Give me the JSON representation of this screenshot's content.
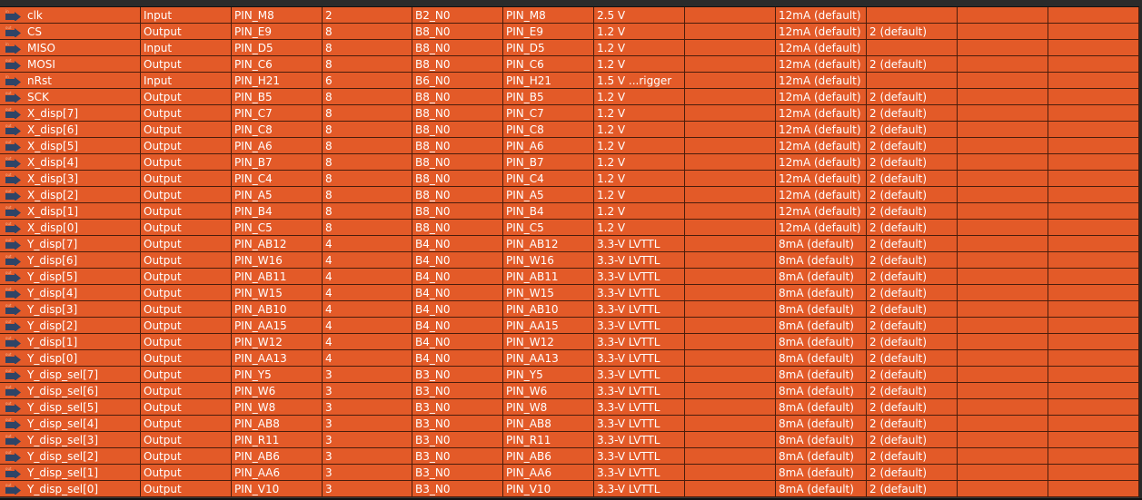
{
  "colors": {
    "row_bg": "#e35a28",
    "grid_line": "#4a1d0c",
    "text": "#ffffff",
    "background": "#3a3a3a"
  },
  "icons": {
    "input": "input-pin-icon",
    "output": "output-pin-icon"
  },
  "rows": [
    {
      "name": "clk",
      "direction": "Input",
      "location": "PIN_M8",
      "bank": "2",
      "vref": "B2_N0",
      "fitter": "PIN_M8",
      "io_std": "2.5 V",
      "reserved": "",
      "current": "12mA (default)",
      "slew": ""
    },
    {
      "name": "CS",
      "direction": "Output",
      "location": "PIN_E9",
      "bank": "8",
      "vref": "B8_N0",
      "fitter": "PIN_E9",
      "io_std": "1.2 V",
      "reserved": "",
      "current": "12mA (default)",
      "slew": "2 (default)"
    },
    {
      "name": "MISO",
      "direction": "Input",
      "location": "PIN_D5",
      "bank": "8",
      "vref": "B8_N0",
      "fitter": "PIN_D5",
      "io_std": "1.2 V",
      "reserved": "",
      "current": "12mA (default)",
      "slew": ""
    },
    {
      "name": "MOSI",
      "direction": "Output",
      "location": "PIN_C6",
      "bank": "8",
      "vref": "B8_N0",
      "fitter": "PIN_C6",
      "io_std": "1.2 V",
      "reserved": "",
      "current": "12mA (default)",
      "slew": "2 (default)"
    },
    {
      "name": "nRst",
      "direction": "Input",
      "location": "PIN_H21",
      "bank": "6",
      "vref": "B6_N0",
      "fitter": "PIN_H21",
      "io_std": "1.5 V ...rigger",
      "reserved": "",
      "current": "12mA (default)",
      "slew": ""
    },
    {
      "name": "SCK",
      "direction": "Output",
      "location": "PIN_B5",
      "bank": "8",
      "vref": "B8_N0",
      "fitter": "PIN_B5",
      "io_std": "1.2 V",
      "reserved": "",
      "current": "12mA (default)",
      "slew": "2 (default)"
    },
    {
      "name": "X_disp[7]",
      "direction": "Output",
      "location": "PIN_C7",
      "bank": "8",
      "vref": "B8_N0",
      "fitter": "PIN_C7",
      "io_std": "1.2 V",
      "reserved": "",
      "current": "12mA (default)",
      "slew": "2 (default)"
    },
    {
      "name": "X_disp[6]",
      "direction": "Output",
      "location": "PIN_C8",
      "bank": "8",
      "vref": "B8_N0",
      "fitter": "PIN_C8",
      "io_std": "1.2 V",
      "reserved": "",
      "current": "12mA (default)",
      "slew": "2 (default)"
    },
    {
      "name": "X_disp[5]",
      "direction": "Output",
      "location": "PIN_A6",
      "bank": "8",
      "vref": "B8_N0",
      "fitter": "PIN_A6",
      "io_std": "1.2 V",
      "reserved": "",
      "current": "12mA (default)",
      "slew": "2 (default)"
    },
    {
      "name": "X_disp[4]",
      "direction": "Output",
      "location": "PIN_B7",
      "bank": "8",
      "vref": "B8_N0",
      "fitter": "PIN_B7",
      "io_std": "1.2 V",
      "reserved": "",
      "current": "12mA (default)",
      "slew": "2 (default)"
    },
    {
      "name": "X_disp[3]",
      "direction": "Output",
      "location": "PIN_C4",
      "bank": "8",
      "vref": "B8_N0",
      "fitter": "PIN_C4",
      "io_std": "1.2 V",
      "reserved": "",
      "current": "12mA (default)",
      "slew": "2 (default)"
    },
    {
      "name": "X_disp[2]",
      "direction": "Output",
      "location": "PIN_A5",
      "bank": "8",
      "vref": "B8_N0",
      "fitter": "PIN_A5",
      "io_std": "1.2 V",
      "reserved": "",
      "current": "12mA (default)",
      "slew": "2 (default)"
    },
    {
      "name": "X_disp[1]",
      "direction": "Output",
      "location": "PIN_B4",
      "bank": "8",
      "vref": "B8_N0",
      "fitter": "PIN_B4",
      "io_std": "1.2 V",
      "reserved": "",
      "current": "12mA (default)",
      "slew": "2 (default)"
    },
    {
      "name": "X_disp[0]",
      "direction": "Output",
      "location": "PIN_C5",
      "bank": "8",
      "vref": "B8_N0",
      "fitter": "PIN_C5",
      "io_std": "1.2 V",
      "reserved": "",
      "current": "12mA (default)",
      "slew": "2 (default)"
    },
    {
      "name": "Y_disp[7]",
      "direction": "Output",
      "location": "PIN_AB12",
      "bank": "4",
      "vref": "B4_N0",
      "fitter": "PIN_AB12",
      "io_std": "3.3-V LVTTL",
      "reserved": "",
      "current": "8mA (default)",
      "slew": "2 (default)"
    },
    {
      "name": "Y_disp[6]",
      "direction": "Output",
      "location": "PIN_W16",
      "bank": "4",
      "vref": "B4_N0",
      "fitter": "PIN_W16",
      "io_std": "3.3-V LVTTL",
      "reserved": "",
      "current": "8mA (default)",
      "slew": "2 (default)"
    },
    {
      "name": "Y_disp[5]",
      "direction": "Output",
      "location": "PIN_AB11",
      "bank": "4",
      "vref": "B4_N0",
      "fitter": "PIN_AB11",
      "io_std": "3.3-V LVTTL",
      "reserved": "",
      "current": "8mA (default)",
      "slew": "2 (default)"
    },
    {
      "name": "Y_disp[4]",
      "direction": "Output",
      "location": "PIN_W15",
      "bank": "4",
      "vref": "B4_N0",
      "fitter": "PIN_W15",
      "io_std": "3.3-V LVTTL",
      "reserved": "",
      "current": "8mA (default)",
      "slew": "2 (default)"
    },
    {
      "name": "Y_disp[3]",
      "direction": "Output",
      "location": "PIN_AB10",
      "bank": "4",
      "vref": "B4_N0",
      "fitter": "PIN_AB10",
      "io_std": "3.3-V LVTTL",
      "reserved": "",
      "current": "8mA (default)",
      "slew": "2 (default)"
    },
    {
      "name": "Y_disp[2]",
      "direction": "Output",
      "location": "PIN_AA15",
      "bank": "4",
      "vref": "B4_N0",
      "fitter": "PIN_AA15",
      "io_std": "3.3-V LVTTL",
      "reserved": "",
      "current": "8mA (default)",
      "slew": "2 (default)"
    },
    {
      "name": "Y_disp[1]",
      "direction": "Output",
      "location": "PIN_W12",
      "bank": "4",
      "vref": "B4_N0",
      "fitter": "PIN_W12",
      "io_std": "3.3-V LVTTL",
      "reserved": "",
      "current": "8mA (default)",
      "slew": "2 (default)"
    },
    {
      "name": "Y_disp[0]",
      "direction": "Output",
      "location": "PIN_AA13",
      "bank": "4",
      "vref": "B4_N0",
      "fitter": "PIN_AA13",
      "io_std": "3.3-V LVTTL",
      "reserved": "",
      "current": "8mA (default)",
      "slew": "2 (default)"
    },
    {
      "name": "Y_disp_sel[7]",
      "direction": "Output",
      "location": "PIN_Y5",
      "bank": "3",
      "vref": "B3_N0",
      "fitter": "PIN_Y5",
      "io_std": "3.3-V LVTTL",
      "reserved": "",
      "current": "8mA (default)",
      "slew": "2 (default)"
    },
    {
      "name": "Y_disp_sel[6]",
      "direction": "Output",
      "location": "PIN_W6",
      "bank": "3",
      "vref": "B3_N0",
      "fitter": "PIN_W6",
      "io_std": "3.3-V LVTTL",
      "reserved": "",
      "current": "8mA (default)",
      "slew": "2 (default)"
    },
    {
      "name": "Y_disp_sel[5]",
      "direction": "Output",
      "location": "PIN_W8",
      "bank": "3",
      "vref": "B3_N0",
      "fitter": "PIN_W8",
      "io_std": "3.3-V LVTTL",
      "reserved": "",
      "current": "8mA (default)",
      "slew": "2 (default)"
    },
    {
      "name": "Y_disp_sel[4]",
      "direction": "Output",
      "location": "PIN_AB8",
      "bank": "3",
      "vref": "B3_N0",
      "fitter": "PIN_AB8",
      "io_std": "3.3-V LVTTL",
      "reserved": "",
      "current": "8mA (default)",
      "slew": "2 (default)"
    },
    {
      "name": "Y_disp_sel[3]",
      "direction": "Output",
      "location": "PIN_R11",
      "bank": "3",
      "vref": "B3_N0",
      "fitter": "PIN_R11",
      "io_std": "3.3-V LVTTL",
      "reserved": "",
      "current": "8mA (default)",
      "slew": "2 (default)"
    },
    {
      "name": "Y_disp_sel[2]",
      "direction": "Output",
      "location": "PIN_AB6",
      "bank": "3",
      "vref": "B3_N0",
      "fitter": "PIN_AB6",
      "io_std": "3.3-V LVTTL",
      "reserved": "",
      "current": "8mA (default)",
      "slew": "2 (default)"
    },
    {
      "name": "Y_disp_sel[1]",
      "direction": "Output",
      "location": "PIN_AA6",
      "bank": "3",
      "vref": "B3_N0",
      "fitter": "PIN_AA6",
      "io_std": "3.3-V LVTTL",
      "reserved": "",
      "current": "8mA (default)",
      "slew": "2 (default)"
    },
    {
      "name": "Y_disp_sel[0]",
      "direction": "Output",
      "location": "PIN_V10",
      "bank": "3",
      "vref": "B3_N0",
      "fitter": "PIN_V10",
      "io_std": "3.3-V LVTTL",
      "reserved": "",
      "current": "8mA (default)",
      "slew": "2 (default)"
    }
  ]
}
